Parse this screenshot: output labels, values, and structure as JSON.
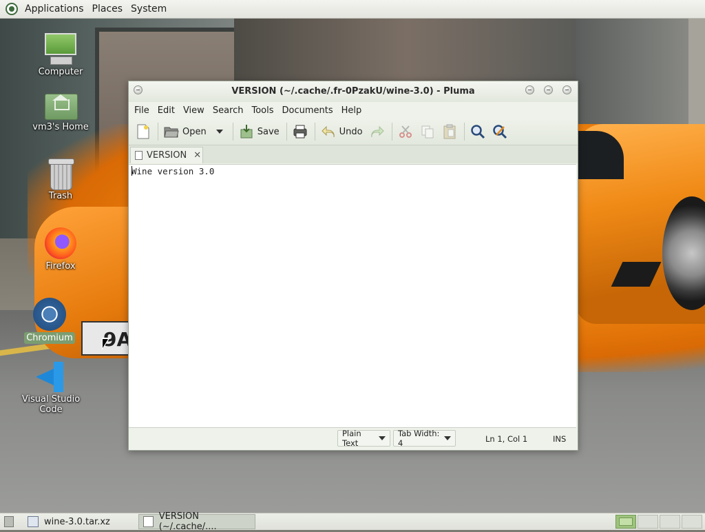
{
  "top_panel": {
    "menus": [
      "Applications",
      "Places",
      "System"
    ]
  },
  "desktop": {
    "icons": [
      {
        "label": "Computer",
        "icon": "computer-icon",
        "selected": false
      },
      {
        "label": "vm3's Home",
        "icon": "home-folder-icon",
        "selected": false
      },
      {
        "label": "Trash",
        "icon": "trash-icon",
        "selected": false
      },
      {
        "label": "Firefox",
        "icon": "firefox-icon",
        "selected": false
      },
      {
        "label": "Chromium",
        "icon": "chromium-icon",
        "selected": true
      },
      {
        "label": "Visual Studio Code",
        "icon": "vscode-icon",
        "selected": false
      }
    ]
  },
  "window": {
    "title": "VERSION (~/.cache/.fr-0PzakU/wine-3.0) - Pluma",
    "menu": [
      "File",
      "Edit",
      "View",
      "Search",
      "Tools",
      "Documents",
      "Help"
    ],
    "toolbar": {
      "new_icon": "new-document-icon",
      "open_label": "Open",
      "save_label": "Save",
      "print_icon": "print-icon",
      "undo_label": "Undo",
      "redo_icon": "redo-icon",
      "cut_icon": "cut-icon",
      "copy_icon": "copy-icon",
      "paste_icon": "paste-icon",
      "find_icon": "find-icon",
      "replace_icon": "find-replace-icon"
    },
    "tab": {
      "label": "VERSION"
    },
    "editor": {
      "text": "Wine version 3.0"
    },
    "status": {
      "language": "Plain Text",
      "tab_width": "Tab Width:  4",
      "position": "Ln 1, Col 1",
      "mode": "INS"
    }
  },
  "taskbar": {
    "tasks": [
      {
        "label": "wine-3.0.tar.xz",
        "active": false
      },
      {
        "label": "VERSION (~/.cache/....",
        "active": true
      }
    ],
    "workspaces": 4,
    "active_workspace": 1
  },
  "colors": {
    "panel_bg": "#e4e4df",
    "window_bg": "#eef2ea",
    "accent_green": "#7b9d71"
  }
}
